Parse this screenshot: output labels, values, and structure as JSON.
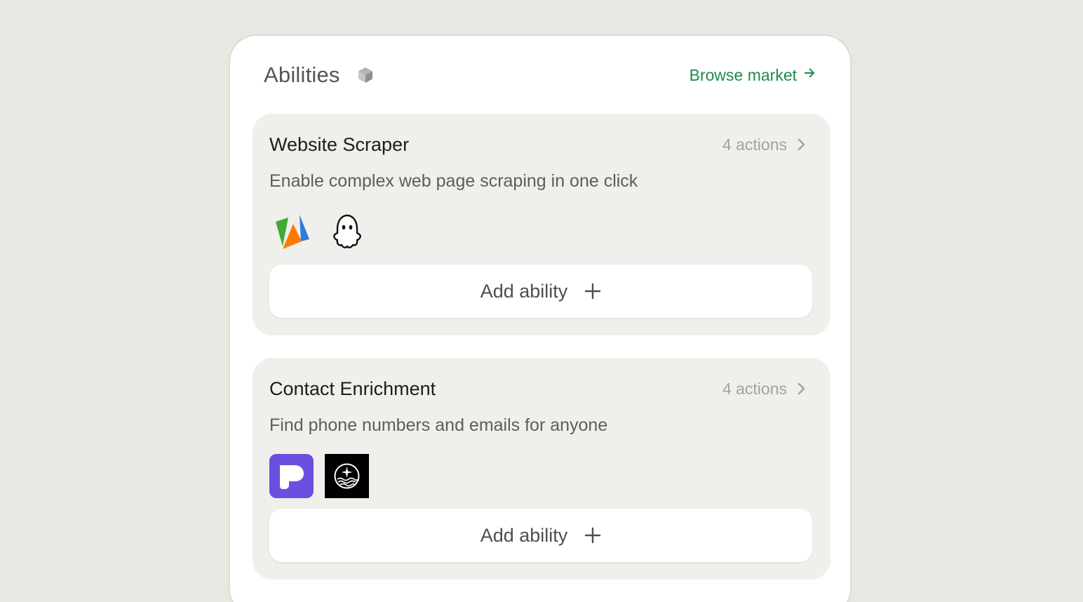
{
  "panel": {
    "title": "Abilities",
    "title_icon": "cube-icon",
    "browse_label": "Browse market",
    "browse_icon": "arrow-right-icon",
    "accent_color": "#1e8a4c"
  },
  "cards": [
    {
      "title": "Website Scraper",
      "actions_label": "4 actions",
      "description": "Enable complex web page scraping in one click",
      "logos": [
        "apify-logo",
        "ghost-logo"
      ],
      "add_label": "Add ability"
    },
    {
      "title": "Contact Enrichment",
      "actions_label": "4 actions",
      "description": "Find phone numbers and emails for anyone",
      "logos": [
        "purple-p-logo",
        "black-waves-logo"
      ],
      "add_label": "Add ability"
    }
  ]
}
